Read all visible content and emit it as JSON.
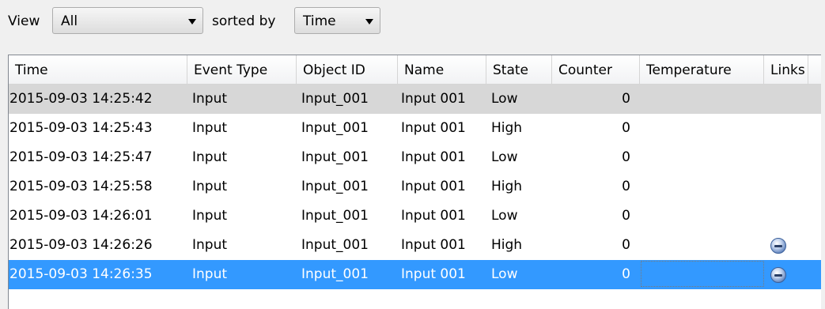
{
  "toolbar": {
    "view_label": "View",
    "view_value": "All",
    "sorted_by_label": "sorted by",
    "sort_value": "Time"
  },
  "table": {
    "columns": [
      "Time",
      "Event Type",
      "Object ID",
      "Name",
      "State",
      "Counter",
      "Temperature",
      "Links"
    ],
    "rows": [
      {
        "time": "2015-09-03 14:25:42",
        "event_type": "Input",
        "object_id": "Input_001",
        "name": "Input 001",
        "state": "Low",
        "counter": "0",
        "temperature": "",
        "link_icon": "",
        "style": "grey"
      },
      {
        "time": "2015-09-03 14:25:43",
        "event_type": "Input",
        "object_id": "Input_001",
        "name": "Input 001",
        "state": "High",
        "counter": "0",
        "temperature": "",
        "link_icon": "",
        "style": "normal"
      },
      {
        "time": "2015-09-03 14:25:47",
        "event_type": "Input",
        "object_id": "Input_001",
        "name": "Input 001",
        "state": "Low",
        "counter": "0",
        "temperature": "",
        "link_icon": "",
        "style": "normal"
      },
      {
        "time": "2015-09-03 14:25:58",
        "event_type": "Input",
        "object_id": "Input_001",
        "name": "Input 001",
        "state": "High",
        "counter": "0",
        "temperature": "",
        "link_icon": "",
        "style": "normal"
      },
      {
        "time": "2015-09-03 14:26:01",
        "event_type": "Input",
        "object_id": "Input_001",
        "name": "Input 001",
        "state": "Low",
        "counter": "0",
        "temperature": "",
        "link_icon": "",
        "style": "normal"
      },
      {
        "time": "2015-09-03 14:26:26",
        "event_type": "Input",
        "object_id": "Input_001",
        "name": "Input 001",
        "state": "High",
        "counter": "0",
        "temperature": "",
        "link_icon": "link-bubble-icon",
        "style": "normal"
      },
      {
        "time": "2015-09-03 14:26:35",
        "event_type": "Input",
        "object_id": "Input_001",
        "name": "Input 001",
        "state": "Low",
        "counter": "0",
        "temperature": "",
        "link_icon": "link-bubble-icon",
        "style": "selected"
      }
    ]
  },
  "colors": {
    "selection": "#3399ff",
    "grey_row": "#d7d7d7"
  }
}
